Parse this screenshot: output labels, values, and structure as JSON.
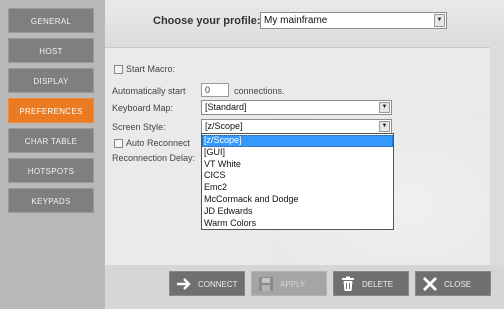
{
  "sidebar": {
    "items": [
      {
        "label": "GENERAL",
        "active": false
      },
      {
        "label": "HOST",
        "active": false
      },
      {
        "label": "DISPLAY",
        "active": false
      },
      {
        "label": "PREFERENCES",
        "active": true
      },
      {
        "label": "CHAR TABLE",
        "active": false
      },
      {
        "label": "HOTSPOTS",
        "active": false
      },
      {
        "label": "KEYPADS",
        "active": false
      }
    ]
  },
  "header": {
    "profile_label": "Choose your profile:",
    "profile_value": "My mainframe"
  },
  "preferences": {
    "start_macro_label": "Start Macro:",
    "auto_start_label": "Automatically start",
    "auto_start_value": "0",
    "connections_label": "connections.",
    "keyboard_map_label": "Keyboard Map:",
    "keyboard_map_value": "[Standard]",
    "screen_style_label": "Screen Style:",
    "screen_style_value": "[z/Scope]",
    "auto_reconnect_label": "Auto Reconnect",
    "reconnection_delay_label": "Reconnection Delay:"
  },
  "screen_style_options": [
    "[z/Scope]",
    "[GUI]",
    "VT White",
    "CICS",
    "Emc2",
    "McCormack and Dodge",
    "JD Edwards",
    "Warm Colors"
  ],
  "footer": {
    "connect_label": "CONNECT",
    "apply_label": "APPLY",
    "delete_label": "DELETE",
    "close_label": "CLOSE"
  },
  "colors": {
    "accent": "#ea7b22",
    "nav_button": "#7f7f7f",
    "selection": "#3399ff"
  }
}
